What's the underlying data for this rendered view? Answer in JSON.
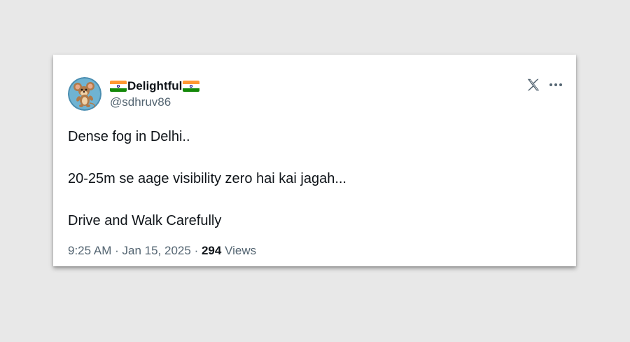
{
  "tweet": {
    "display_name": "Delightful",
    "handle": "@sdhruv86",
    "lines": [
      "Dense fog in Delhi..",
      "20-25m se aage visibility zero hai kai jagah...",
      "Drive and Walk Carefully"
    ],
    "time": "9:25 AM",
    "separator": "·",
    "date": "Jan 15, 2025",
    "views_count": "294",
    "views_label": "Views"
  },
  "icons": {
    "flag": "india-flag-emoji",
    "logo": "x-logo-icon",
    "more": "more-options-icon",
    "avatar": "cartoon-mouse-avatar"
  },
  "colors": {
    "background": "#e8e8e8",
    "card": "#ffffff",
    "text_primary": "#0f1419",
    "text_secondary": "#536471",
    "flag_saffron": "#ff9933",
    "flag_green": "#138808",
    "chakra": "#000080"
  }
}
